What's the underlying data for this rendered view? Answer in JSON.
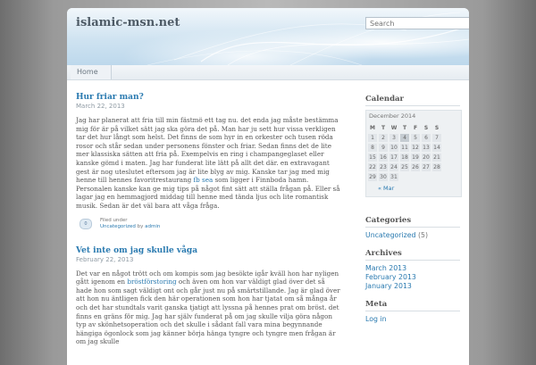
{
  "header": {
    "site_title": "islamic-msn.net",
    "search_placeholder": "Search"
  },
  "nav": {
    "items": [
      "Home"
    ]
  },
  "posts": [
    {
      "title": "Hur friar man?",
      "date": "March 22, 2013",
      "body": [
        "Jag har planerat att fria till min fästmö ett tag nu. det enda jag måste bestämma mig för är på vilket sätt jag ska göra det på. Man har ju sett hur vissa verkligen tar det hur långt som helst. Det finns de som hyr in en orkester och tusen röda rosor och står sedan under personens fönster och friar. Sedan finns det de lite mer klassiska sätten att fria på. Exempelvis en ring i champangeglaset eller kanske gömd i maten. Jag har funderat lite lätt på allt det där. en extravagant gest är nog uteslutet eftersom jag är lite blyg av mig. Kanske tar jag med mig henne till hennes favoritrestaurang",
        "fb sea",
        "som ligger i Finnboda hamn. Personalen kanske kan ge mig tips på något fint sätt att ställa frågan på. Eller så lagar jag en hemmagjord middag till henne med tända ljus och lite romantisk musik. Sedan är det väl bara att våga fråga."
      ],
      "comments": "0",
      "filed_under_label": "Filed under",
      "category": "Uncategorized",
      "by_label": "by",
      "author": "admin"
    },
    {
      "title": "Vet inte om jag skulle våga",
      "date": "February 22, 2013",
      "body": [
        "Det var en något trött och om kompis som jag besökte igår kväll hon har nyligen gått igenom en",
        "bröstförstoring",
        "och även om hon var väldigt glad över det så hade hon som sagt väldigt ont och går just nu på smärtstillande. Jag är glad över att hon nu äntligen fick den här operationen som hon har tjatat om så många år och det har stundtals varit ganska tjatigt att lyssna på hennes prat om bröst. det finns en gräns för mig. Jag har själv funderat på om jag skulle vilja göra någon typ av skönhetsoperation och det skulle i sådant fall vara mina begynnande hängiga ögonlock som jag känner börja hänga tyngre och tyngre men frågan är om jag skulle"
      ]
    }
  ],
  "sidebar": {
    "calendar": {
      "title": "Calendar",
      "caption": "December 2014",
      "weekdays": [
        "M",
        "T",
        "W",
        "T",
        "F",
        "S",
        "S"
      ],
      "rows": [
        [
          "1",
          "2",
          "3",
          "4",
          "5",
          "6",
          "7"
        ],
        [
          "8",
          "9",
          "10",
          "11",
          "12",
          "13",
          "14"
        ],
        [
          "15",
          "16",
          "17",
          "18",
          "19",
          "20",
          "21"
        ],
        [
          "22",
          "23",
          "24",
          "25",
          "26",
          "27",
          "28"
        ],
        [
          "29",
          "30",
          "31",
          "",
          "",
          "",
          ""
        ]
      ],
      "today": "4",
      "prev_link": "« Mar"
    },
    "categories": {
      "title": "Categories",
      "items": [
        {
          "label": "Uncategorized",
          "count": "(5)"
        }
      ]
    },
    "archives": {
      "title": "Archives",
      "items": [
        "March 2013",
        "February 2013",
        "January 2013"
      ]
    },
    "meta": {
      "title": "Meta",
      "items": [
        "Log in"
      ]
    }
  },
  "colors": {
    "link": "#2a7ab0",
    "text": "#555555",
    "header_blue": "#cfe3f1"
  }
}
